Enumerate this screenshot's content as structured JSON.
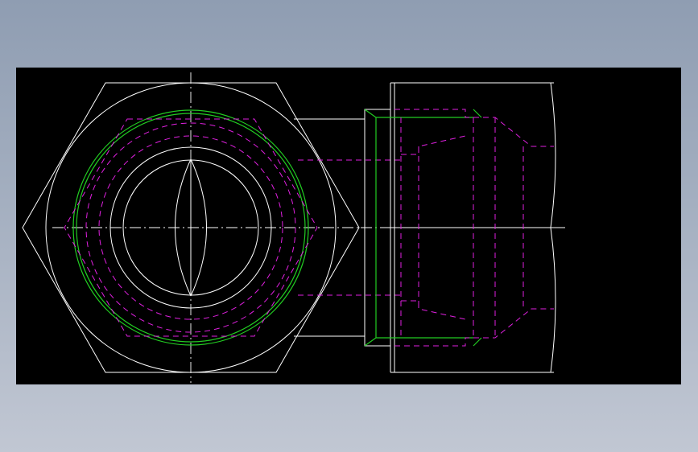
{
  "colors": {
    "canvas_background": "#000000",
    "visible_edges": "#ffffff",
    "hidden_edges": "#e020e0",
    "thread_lines": "#22cc22",
    "app_background": "#a4afc0"
  },
  "views": [
    "front-view-hex-nut",
    "side-view-hex-nut"
  ]
}
